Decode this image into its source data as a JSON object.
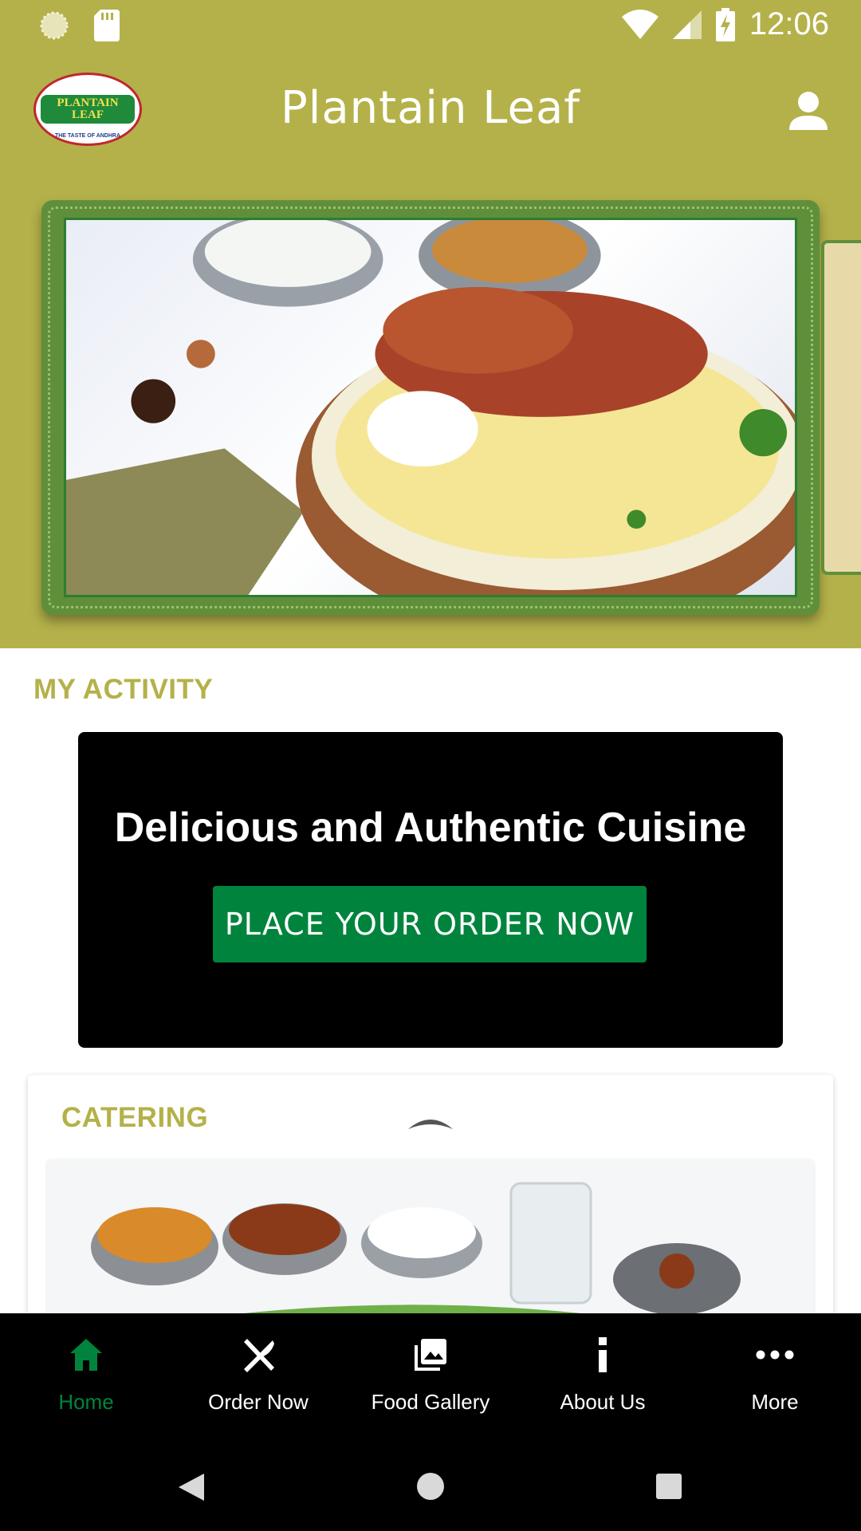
{
  "status_bar": {
    "time": "12:06"
  },
  "app_bar": {
    "title": "Plantain Leaf",
    "logo_line1": "PLANTAIN",
    "logo_line2": "LEAF",
    "logo_tagline": "THE TASTE OF ANDHRA"
  },
  "sections": {
    "my_activity": "MY ACTIVITY",
    "catering": "CATERING"
  },
  "promo": {
    "title": "Delicious and Authentic Cuisine",
    "button_label": "PLACE YOUR ORDER NOW"
  },
  "bottom_nav": {
    "items": [
      {
        "label": "Home",
        "icon": "home-icon",
        "active": true
      },
      {
        "label": "Order Now",
        "icon": "fork-knife-icon",
        "active": false
      },
      {
        "label": "Food Gallery",
        "icon": "gallery-icon",
        "active": false
      },
      {
        "label": "About Us",
        "icon": "info-icon",
        "active": false
      },
      {
        "label": "More",
        "icon": "more-dots-icon",
        "active": false
      }
    ]
  },
  "colors": {
    "brand_olive": "#b4b14a",
    "accent_green": "#00843d",
    "nav_background": "#000000"
  }
}
